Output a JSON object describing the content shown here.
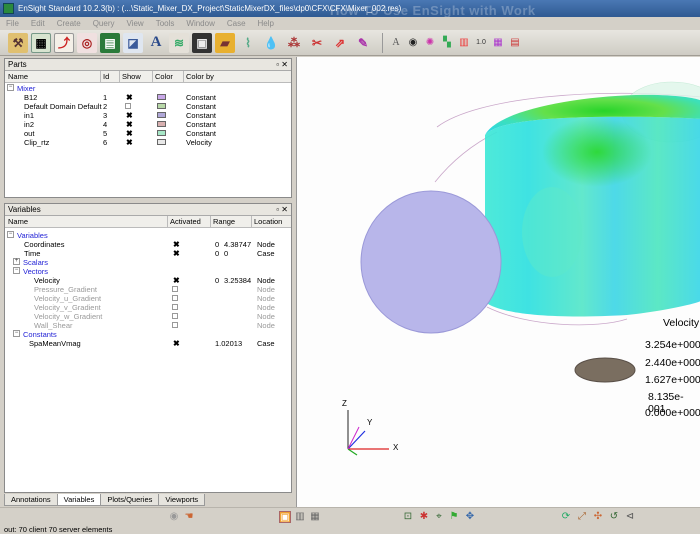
{
  "window": {
    "title": "EnSight Standard 10.2.3(b) : (...\\Static_Mixer_DX_Project\\StaticMixerDX_files\\dp0\\CFX\\CFX\\Mixer_002.res)",
    "ghost_text": "How To Use EnSight with Work"
  },
  "menu": [
    "File",
    "Edit",
    "Create",
    "Query",
    "View",
    "Tools",
    "Window",
    "Case",
    "Help"
  ],
  "parts_panel": {
    "title": "Parts",
    "columns": [
      "Name",
      "Id",
      "Show",
      "Color",
      "Color by"
    ],
    "group": "Mixer",
    "rows": [
      {
        "name": "B12",
        "id": "1",
        "show": true,
        "color": "#c8a8e8",
        "color_by": "Constant"
      },
      {
        "name": "Default Domain Default",
        "id": "2",
        "show": false,
        "color": "#b8d8a8",
        "color_by": "Constant"
      },
      {
        "name": "in1",
        "id": "3",
        "show": true,
        "color": "#b0a8d8",
        "color_by": "Constant"
      },
      {
        "name": "in2",
        "id": "4",
        "show": true,
        "color": "#d8b0b0",
        "color_by": "Constant"
      },
      {
        "name": "out",
        "id": "5",
        "show": true,
        "color": "#a8e8c8",
        "color_by": "Constant"
      },
      {
        "name": "Clip_rtz",
        "id": "6",
        "show": true,
        "color": "#e8e8e8",
        "color_by": "Velocity"
      }
    ]
  },
  "variables_panel": {
    "title": "Variables",
    "columns": [
      "Name",
      "Activated",
      "Range",
      "Location"
    ],
    "group": "Variables",
    "rows": [
      {
        "name": "Coordinates",
        "activated": true,
        "range_min": "0",
        "range_max": "4.38747",
        "location": "Node",
        "grey": false
      },
      {
        "name": "Time",
        "activated": true,
        "range_min": "0",
        "range_max": "0",
        "location": "Case",
        "grey": false
      }
    ],
    "scalars_label": "Scalars",
    "vectors_label": "Vectors",
    "vector_rows": [
      {
        "name": "Velocity",
        "activated": true,
        "range_min": "0",
        "range_max": "3.25384",
        "location": "Node",
        "grey": false
      },
      {
        "name": "Pressure_Gradient",
        "activated": false,
        "range_min": "",
        "range_max": "",
        "location": "Node",
        "grey": true
      },
      {
        "name": "Velocity_u_Gradient",
        "activated": false,
        "range_min": "",
        "range_max": "",
        "location": "Node",
        "grey": true
      },
      {
        "name": "Velocity_v_Gradient",
        "activated": false,
        "range_min": "",
        "range_max": "",
        "location": "Node",
        "grey": true
      },
      {
        "name": "Velocity_w_Gradient",
        "activated": false,
        "range_min": "",
        "range_max": "",
        "location": "Node",
        "grey": true
      },
      {
        "name": "Wall_Shear",
        "activated": false,
        "range_min": "",
        "range_max": "",
        "location": "Node",
        "grey": true
      }
    ],
    "constants_label": "Constants",
    "constant_rows": [
      {
        "name": "SpaMeanVmag",
        "activated": true,
        "range": "1.02013",
        "location": "Case"
      }
    ]
  },
  "tabs": [
    "Annotations",
    "Variables",
    "Plots/Queries",
    "Viewports"
  ],
  "active_tab": "Variables",
  "status_text": "out: 70 client 70 server elements",
  "legend": {
    "title": "Velocity",
    "values": [
      "3.254e+000",
      "2.440e+000",
      "1.627e+000",
      "8.135e-001",
      "0.000e+000"
    ]
  },
  "axes": {
    "x": "X",
    "y": "Y",
    "z": "Z"
  },
  "colors": {
    "accent": "#2323d6",
    "titlebar": "#3a66a0"
  }
}
